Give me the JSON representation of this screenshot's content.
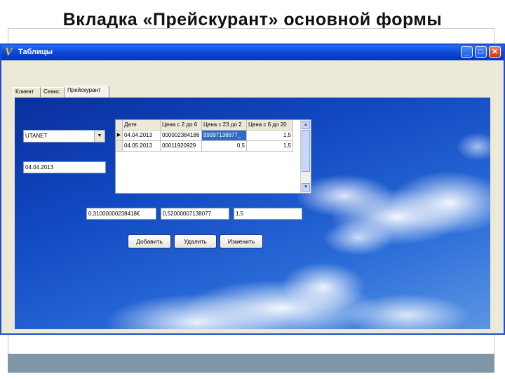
{
  "slide": {
    "title": "Вкладка «Прейскурант» основной формы"
  },
  "window": {
    "title": "Таблицы",
    "icon": "V",
    "controls": [
      "minimize",
      "maximize",
      "close"
    ]
  },
  "tabs": [
    {
      "label": "Клиент",
      "active": false
    },
    {
      "label": "Сеанс",
      "active": false
    },
    {
      "label": "Прейскурант",
      "active": true
    }
  ],
  "combo": {
    "value": "UTANET"
  },
  "date_field": {
    "value": "04.04.2013"
  },
  "grid": {
    "headers": [
      "Дате",
      "Цена с 2 до 6",
      "Цена с 23 до 2",
      "Цена с 6 до 20"
    ],
    "rows": [
      [
        "04.04.2013",
        "000002384186",
        "99997138677_",
        "1,5"
      ],
      [
        "04.05.2013",
        "00011920929",
        "0.5",
        "1,5"
      ]
    ]
  },
  "inputs": {
    "price1": "0,31000000238418€",
    "price2": "0,52000007138077",
    "price3": "1.5"
  },
  "buttons": {
    "add": "Добавить",
    "delete": "Удалить",
    "edit": "Изменить"
  },
  "colors": {
    "titlebar": "#0a46d8",
    "selection": "#316ac5",
    "band": "#7f97a6"
  }
}
